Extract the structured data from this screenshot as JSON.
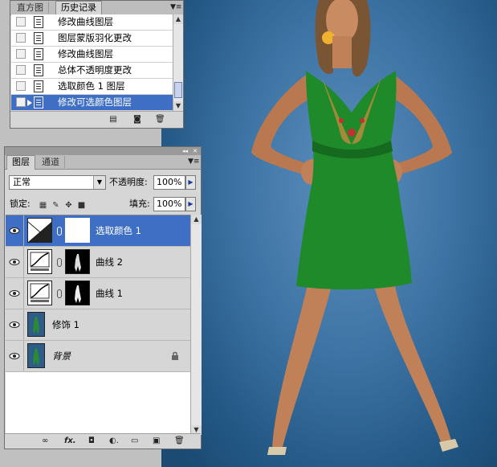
{
  "history_panel": {
    "tabs": [
      {
        "label": "直方图",
        "active": false
      },
      {
        "label": "历史记录",
        "active": true
      }
    ],
    "items": [
      {
        "label": "修改曲线图层",
        "selected": false
      },
      {
        "label": "图层蒙版羽化更改",
        "selected": false
      },
      {
        "label": "修改曲线图层",
        "selected": false
      },
      {
        "label": "总体不透明度更改",
        "selected": false
      },
      {
        "label": "选取颜色 1 图层",
        "selected": false
      },
      {
        "label": "修改可选颜色图层",
        "selected": true
      }
    ],
    "footer_icons": [
      "new-document-from-state-icon",
      "snapshot-camera-icon",
      "trash-icon"
    ]
  },
  "layers_panel": {
    "tabs": [
      {
        "label": "图层",
        "active": true
      },
      {
        "label": "通道",
        "active": false
      }
    ],
    "blend_mode": "正常",
    "opacity_label": "不透明度:",
    "opacity_value": "100%",
    "lock_label": "锁定:",
    "fill_label": "填充:",
    "fill_value": "100%",
    "layers": [
      {
        "name": "选取颜色 1",
        "type": "adjustment-selective-color",
        "visible": true,
        "selected": true,
        "has_mask": true
      },
      {
        "name": "曲线 2",
        "type": "adjustment-curves",
        "visible": true,
        "selected": false,
        "has_mask": true
      },
      {
        "name": "曲线 1",
        "type": "adjustment-curves",
        "visible": true,
        "selected": false,
        "has_mask": true
      },
      {
        "name": "修饰 1",
        "type": "pixel",
        "visible": true,
        "selected": false,
        "has_mask": false
      },
      {
        "name": "背景",
        "type": "background",
        "visible": true,
        "selected": false,
        "has_mask": false,
        "locked": true
      }
    ],
    "footer_icons": [
      "link-layers-icon",
      "fx-icon",
      "add-mask-icon",
      "adjustment-layer-icon",
      "new-group-icon",
      "new-layer-icon",
      "trash-icon"
    ]
  },
  "colors": {
    "selection": "#3f6fc5",
    "panel_bg": "#d6d6d6",
    "photo_bg": "#3e74a5",
    "dress": "#1e8a2a"
  }
}
